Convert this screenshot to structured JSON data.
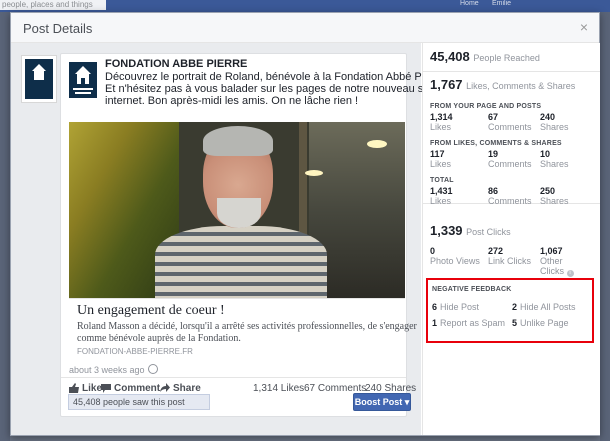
{
  "background": {
    "search_placeholder": "people, places and things",
    "nav_home": "Home",
    "nav_user": "Emilie"
  },
  "modal": {
    "title": "Post Details",
    "close_label": "×"
  },
  "post": {
    "page_name": "FONDATION ABBE PIERRE",
    "text_lines": [
      "Découvrez le portrait de Roland, bénévole à la Fondation Abbé Pierre.",
      "Et n'hésitez pas à vous balader sur les pages de notre nouveau site",
      "internet. Bon après-midi les amis. On ne lâche rien !"
    ],
    "link": {
      "title": "Un engagement de coeur !",
      "desc_lines": [
        "Roland Masson a décidé, lorsqu'il a arrêté ses activités professionnelles, de s'engager",
        "comme bénévole auprès de la Fondation."
      ],
      "domain": "FONDATION-ABBE-PIERRE.FR"
    },
    "timestamp": "about 3 weeks ago",
    "actions": {
      "like": "Like",
      "comment": "Comment",
      "share": "Share"
    },
    "stats": {
      "likes": "1,314 Likes",
      "comments": "67 Comments",
      "shares": "240 Shares"
    },
    "reach_text": "45,408 people saw this post",
    "boost_label": "Boost Post ▾"
  },
  "insights": {
    "reached": {
      "value": "45,408",
      "label": "People Reached"
    },
    "engagement": {
      "value": "1,767",
      "label": "Likes, Comments & Shares"
    },
    "from_page": {
      "header": "FROM YOUR PAGE AND POSTS",
      "cells": [
        {
          "value": "1,314",
          "label": "Likes"
        },
        {
          "value": "67",
          "label": "Comments"
        },
        {
          "value": "240",
          "label": "Shares"
        }
      ]
    },
    "from_shares": {
      "header": "FROM LIKES, COMMENTS & SHARES",
      "cells": [
        {
          "value": "117",
          "label": "Likes"
        },
        {
          "value": "19",
          "label": "Comments"
        },
        {
          "value": "10",
          "label": "Shares"
        }
      ]
    },
    "total": {
      "header": "TOTAL",
      "cells": [
        {
          "value": "1,431",
          "label": "Likes"
        },
        {
          "value": "86",
          "label": "Comments"
        },
        {
          "value": "250",
          "label": "Shares"
        }
      ]
    },
    "clicks": {
      "value": "1,339",
      "label": "Post Clicks",
      "cells": [
        {
          "value": "0",
          "label": "Photo Views"
        },
        {
          "value": "272",
          "label": "Link Clicks"
        },
        {
          "value": "1,067",
          "label": "Other",
          "label2": "Clicks"
        }
      ]
    },
    "negative": {
      "header": "NEGATIVE FEEDBACK",
      "hide_post": {
        "value": "6",
        "label": "Hide Post"
      },
      "hide_all": {
        "value": "2",
        "label": "Hide All Posts"
      },
      "spam": {
        "value": "1",
        "label": "Report as Spam"
      },
      "unlike": {
        "value": "5",
        "label": "Unlike Page"
      }
    },
    "highlight_color": "#e8000b"
  }
}
